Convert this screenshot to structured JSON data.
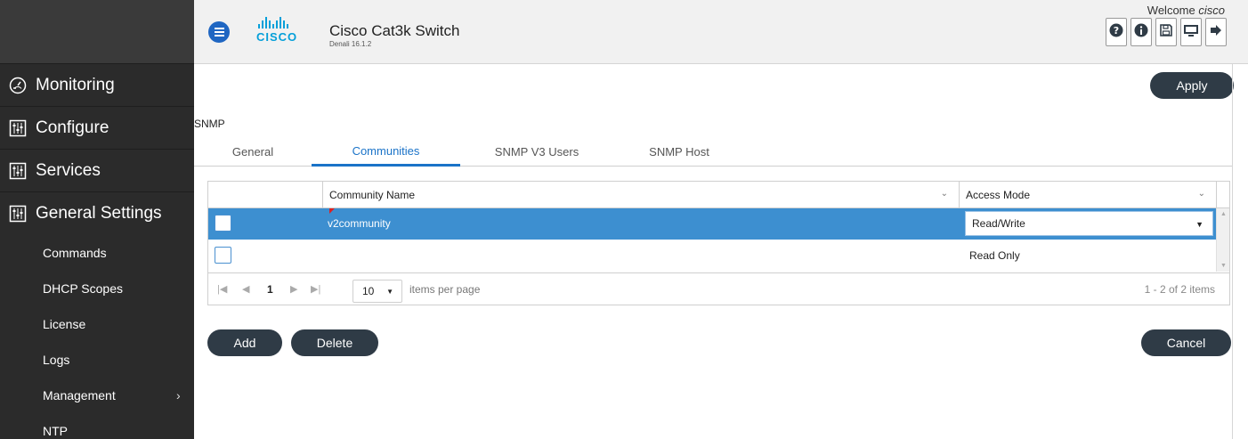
{
  "header": {
    "logo_text": "CISCO",
    "title": "Cisco Cat3k Switch",
    "version": "Denali 16.1.2",
    "welcome_prefix": "Welcome",
    "welcome_user": "cisco",
    "tools": [
      "help-icon",
      "info-icon",
      "save-icon",
      "monitor-icon",
      "logout-icon"
    ]
  },
  "sidebar": {
    "menu": [
      {
        "label": "Monitoring",
        "icon": "gauge-icon"
      },
      {
        "label": "Configure",
        "icon": "sliders-icon"
      },
      {
        "label": "Services",
        "icon": "sliders-icon"
      },
      {
        "label": "General Settings",
        "icon": "sliders-icon"
      }
    ],
    "sub_items": [
      "Commands",
      "DHCP Scopes",
      "License",
      "Logs",
      "Management",
      "NTP"
    ]
  },
  "main": {
    "apply_label": "Apply",
    "section": "SNMP",
    "tabs": [
      "General",
      "Communities",
      "SNMP V3 Users",
      "SNMP Host"
    ],
    "active_tab": "Communities",
    "grid": {
      "columns": [
        "Community Name",
        "Access Mode"
      ],
      "rows": [
        {
          "name": "v2community",
          "mode": "Read/Write",
          "selected": true
        },
        {
          "name": "",
          "mode": "Read Only",
          "selected": false
        }
      ],
      "pager": {
        "page": "1",
        "page_size": "10",
        "per_page_label": "items per page",
        "count": "1 - 2 of 2 items"
      }
    },
    "add_label": "Add",
    "delete_label": "Delete",
    "cancel_label": "Cancel"
  },
  "colors": {
    "accent": "#1a73c8",
    "selected_row": "#3d8fd0",
    "button": "#2f3b46",
    "sidebar": "#2b2b2b",
    "cisco_blue": "#049fd9"
  }
}
